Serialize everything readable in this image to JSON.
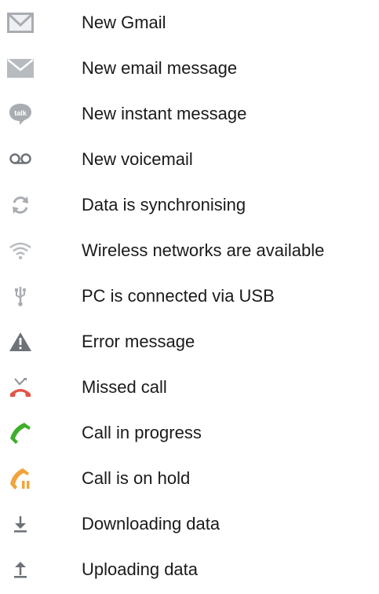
{
  "colors": {
    "icon_gray": "#a9adb2",
    "icon_dark_gray": "#6d7278",
    "missed_red": "#e2554a",
    "call_green": "#3fae2a",
    "hold_orange": "#f2a33a",
    "text": "#1a1a1a"
  },
  "items": [
    {
      "icon": "gmail-icon",
      "label": "New Gmail"
    },
    {
      "icon": "email-icon",
      "label": "New email message"
    },
    {
      "icon": "talk-icon",
      "label": "New instant message"
    },
    {
      "icon": "voicemail-icon",
      "label": "New voicemail"
    },
    {
      "icon": "sync-icon",
      "label": "Data is synchronising"
    },
    {
      "icon": "wifi-icon",
      "label": "Wireless networks are available"
    },
    {
      "icon": "usb-icon",
      "label": "PC is connected via USB"
    },
    {
      "icon": "warning-icon",
      "label": "Error message"
    },
    {
      "icon": "missed-call-icon",
      "label": "Missed call"
    },
    {
      "icon": "call-in-progress-icon",
      "label": "Call in progress"
    },
    {
      "icon": "call-on-hold-icon",
      "label": "Call is on hold"
    },
    {
      "icon": "download-icon",
      "label": "Downloading data"
    },
    {
      "icon": "upload-icon",
      "label": "Uploading data"
    }
  ],
  "talk_icon_text": "talk"
}
